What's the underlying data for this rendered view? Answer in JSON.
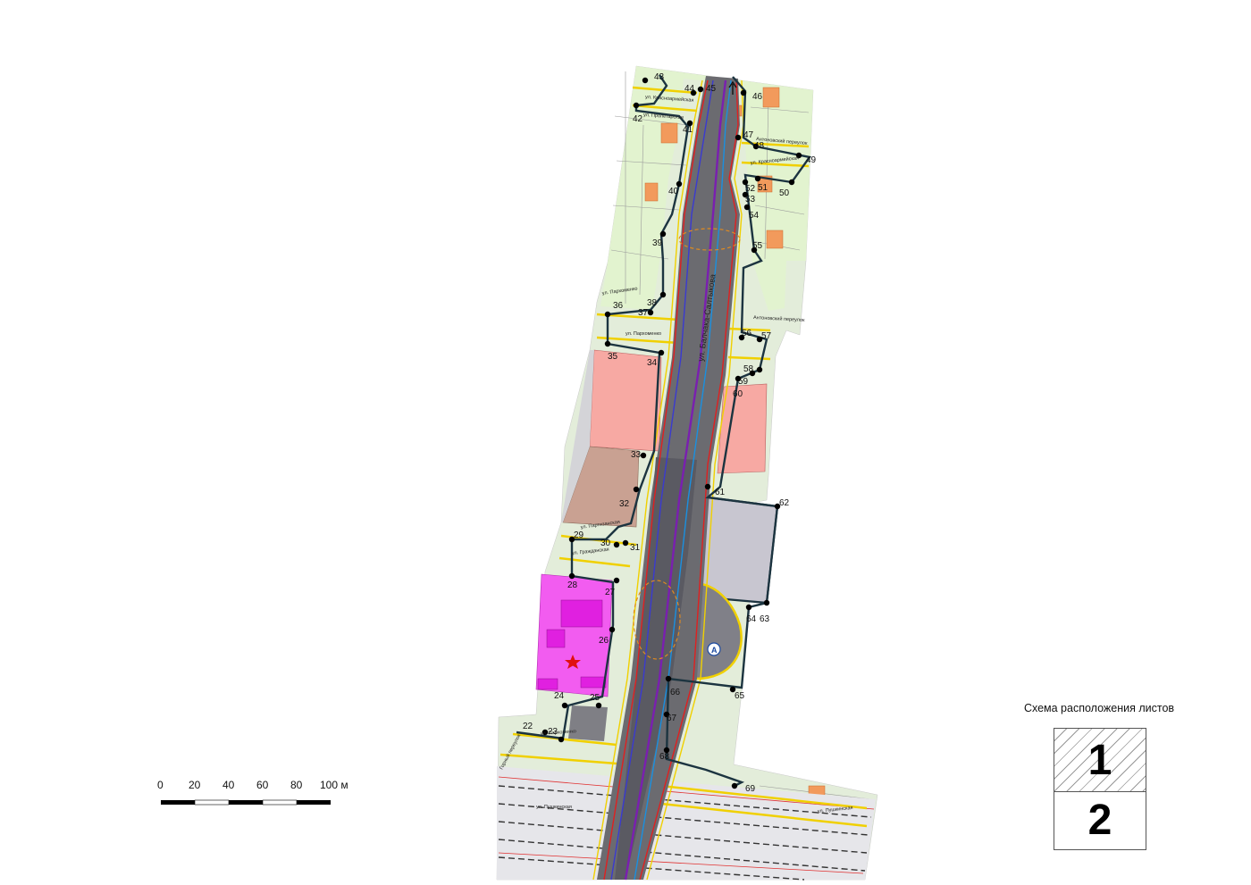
{
  "points": [
    {
      "n": "22"
    },
    {
      "n": "23"
    },
    {
      "n": "24"
    },
    {
      "n": "25"
    },
    {
      "n": "26"
    },
    {
      "n": "27"
    },
    {
      "n": "28"
    },
    {
      "n": "29"
    },
    {
      "n": "30"
    },
    {
      "n": "31"
    },
    {
      "n": "32"
    },
    {
      "n": "33"
    },
    {
      "n": "34"
    },
    {
      "n": "35"
    },
    {
      "n": "36"
    },
    {
      "n": "37"
    },
    {
      "n": "38"
    },
    {
      "n": "39"
    },
    {
      "n": "40"
    },
    {
      "n": "41"
    },
    {
      "n": "42"
    },
    {
      "n": "43"
    },
    {
      "n": "44"
    },
    {
      "n": "45"
    },
    {
      "n": "46"
    },
    {
      "n": "47"
    },
    {
      "n": "48"
    },
    {
      "n": "49"
    },
    {
      "n": "50"
    },
    {
      "n": "51"
    },
    {
      "n": "52"
    },
    {
      "n": "53"
    },
    {
      "n": "54"
    },
    {
      "n": "55"
    },
    {
      "n": "56"
    },
    {
      "n": "57"
    },
    {
      "n": "58"
    },
    {
      "n": "59"
    },
    {
      "n": "60"
    },
    {
      "n": "61"
    },
    {
      "n": "62"
    },
    {
      "n": "63"
    },
    {
      "n": "64"
    },
    {
      "n": "65"
    },
    {
      "n": "66"
    },
    {
      "n": "67"
    },
    {
      "n": "68"
    },
    {
      "n": "69"
    }
  ],
  "streets": {
    "main": "ул. Балчака-Салтыкова",
    "s1": "ул. Красноармейская",
    "s2": "ул. Пролетарская",
    "s3": "Антоновский переулок",
    "s4": "ул. Красноармейская",
    "s5": "ул. Пархоменко",
    "s6": "Антоновский переулок",
    "s7": "ул. Пархоменко",
    "s8": "ул. Партизанская",
    "s9": "ул. Гражданская",
    "s10": "ул. Пушкинская",
    "s11": "Горный переулок",
    "s12": "ул. Пушкинская",
    "s13": "ул. Пархоменко"
  },
  "scale_bar": {
    "ticks": [
      "0",
      "20",
      "40",
      "60",
      "80",
      "100 м"
    ]
  },
  "sheet_scheme": {
    "title": "Схема расположения листов",
    "sheets": [
      "1",
      "2"
    ]
  },
  "colors": {
    "residential": "#dff2cf",
    "commercial": "#f7a9a3",
    "industrial": "#c9c7cf",
    "public": "#f25cf0",
    "brown_zone": "#c9a192",
    "road": "#6b6b70",
    "boundary": "#1c3440"
  }
}
